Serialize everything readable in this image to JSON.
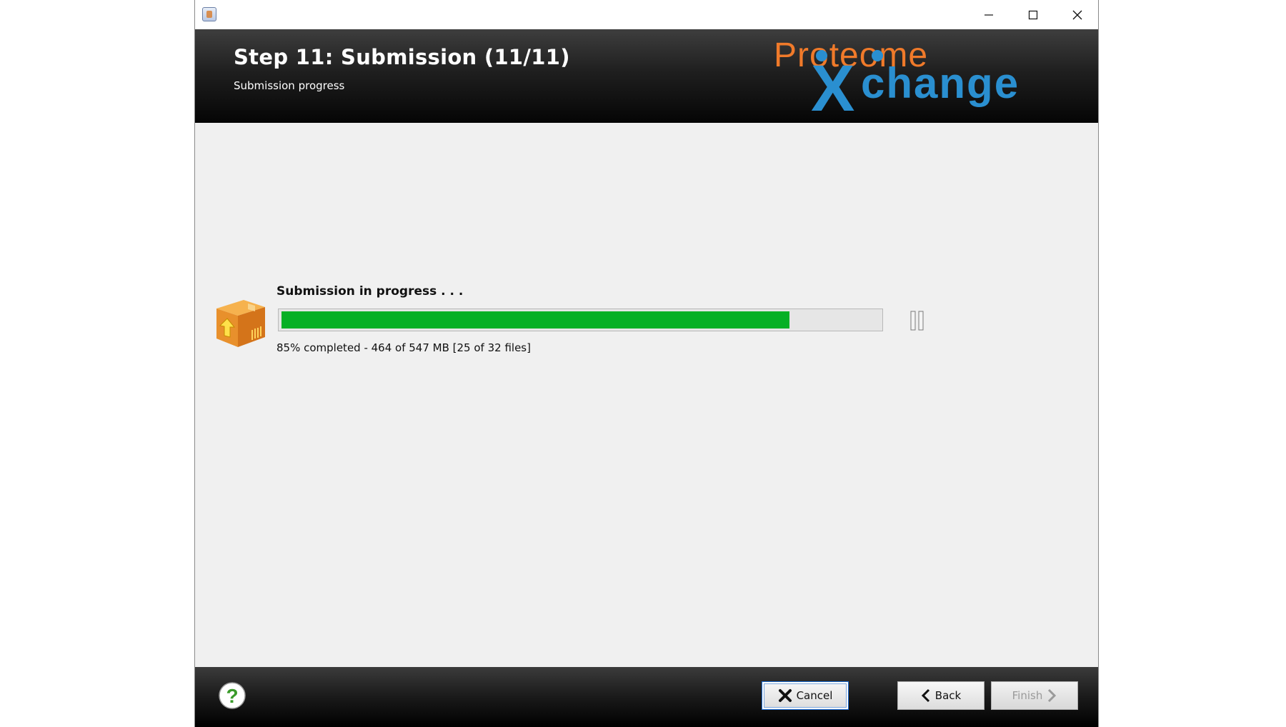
{
  "window": {
    "icon": "java-app-icon",
    "controls": {
      "minimize": "minimize-icon",
      "maximize": "maximize-icon",
      "close": "close-icon"
    }
  },
  "header": {
    "title": "Step 11: Submission (11/11)",
    "subtitle": "Submission progress",
    "logo_text_top": "Proteome",
    "logo_text_bottom": "change",
    "logo_letter": "X",
    "colors": {
      "logo_orange": "#f07a2a",
      "logo_blue": "#2a8fd0"
    }
  },
  "progress": {
    "label": "Submission in progress . . .",
    "percent": 85,
    "status_text": "85% completed - 464 of 547 MB [25 of 32 files]",
    "bar_color": "#06b025",
    "icon": "package-upload-icon",
    "pause_icon": "pause-icon"
  },
  "footer": {
    "help_icon": "help-icon",
    "cancel_label": "Cancel",
    "back_label": "Back",
    "finish_label": "Finish"
  }
}
